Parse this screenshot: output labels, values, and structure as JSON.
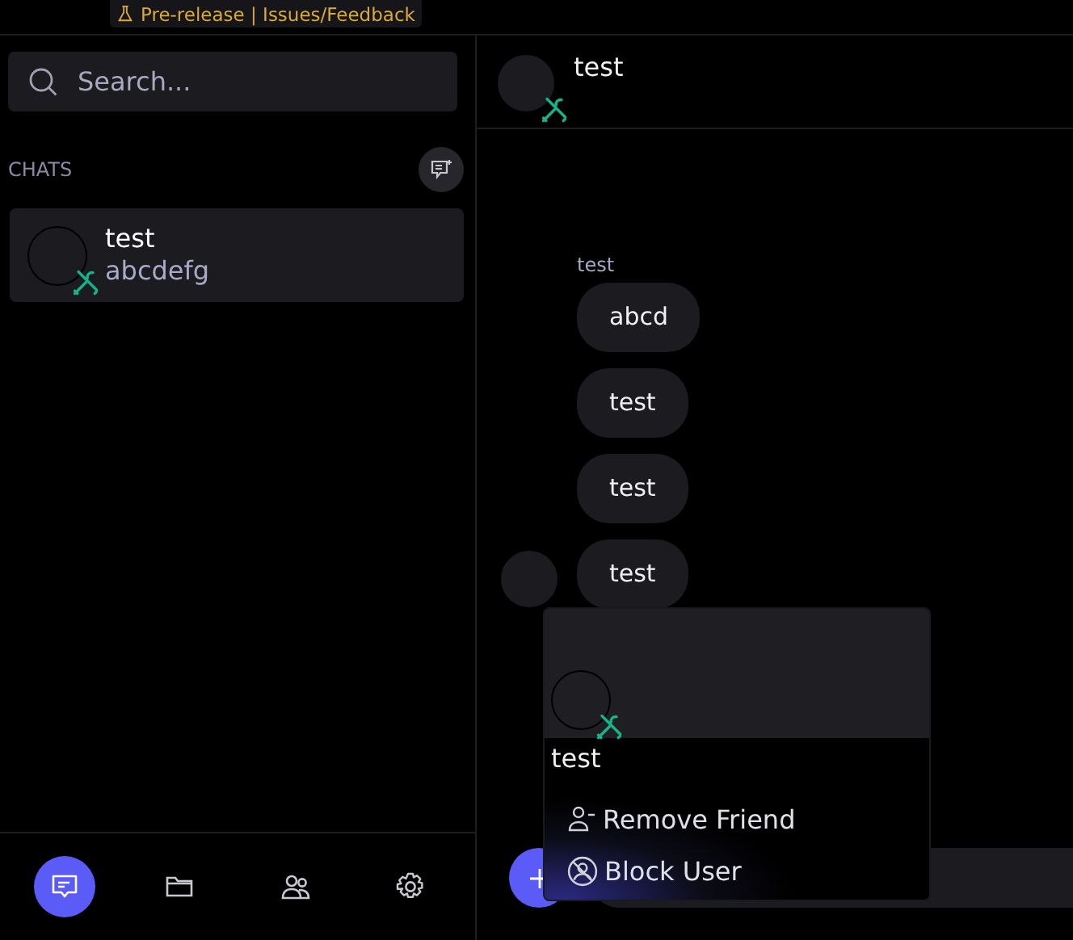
{
  "top_banner": {
    "label": "Pre-release | Issues/Feedback"
  },
  "search": {
    "placeholder": "Search..."
  },
  "chats_heading": "CHATS",
  "chats": [
    {
      "name": "test",
      "last_message": "abcdefg",
      "selected": true
    }
  ],
  "nav": [
    {
      "kind": "chat",
      "selected": true
    },
    {
      "kind": "files",
      "selected": false
    },
    {
      "kind": "friends",
      "selected": false
    },
    {
      "kind": "settings",
      "selected": false
    }
  ],
  "conversation": {
    "title": "test",
    "sender": "test",
    "messages": [
      "abcd",
      "test",
      "test",
      "test"
    ]
  },
  "profile_popup": {
    "name": "test",
    "actions": [
      {
        "kind": "remove",
        "label": "Remove Friend"
      },
      {
        "kind": "block",
        "label": "Block User"
      }
    ]
  }
}
